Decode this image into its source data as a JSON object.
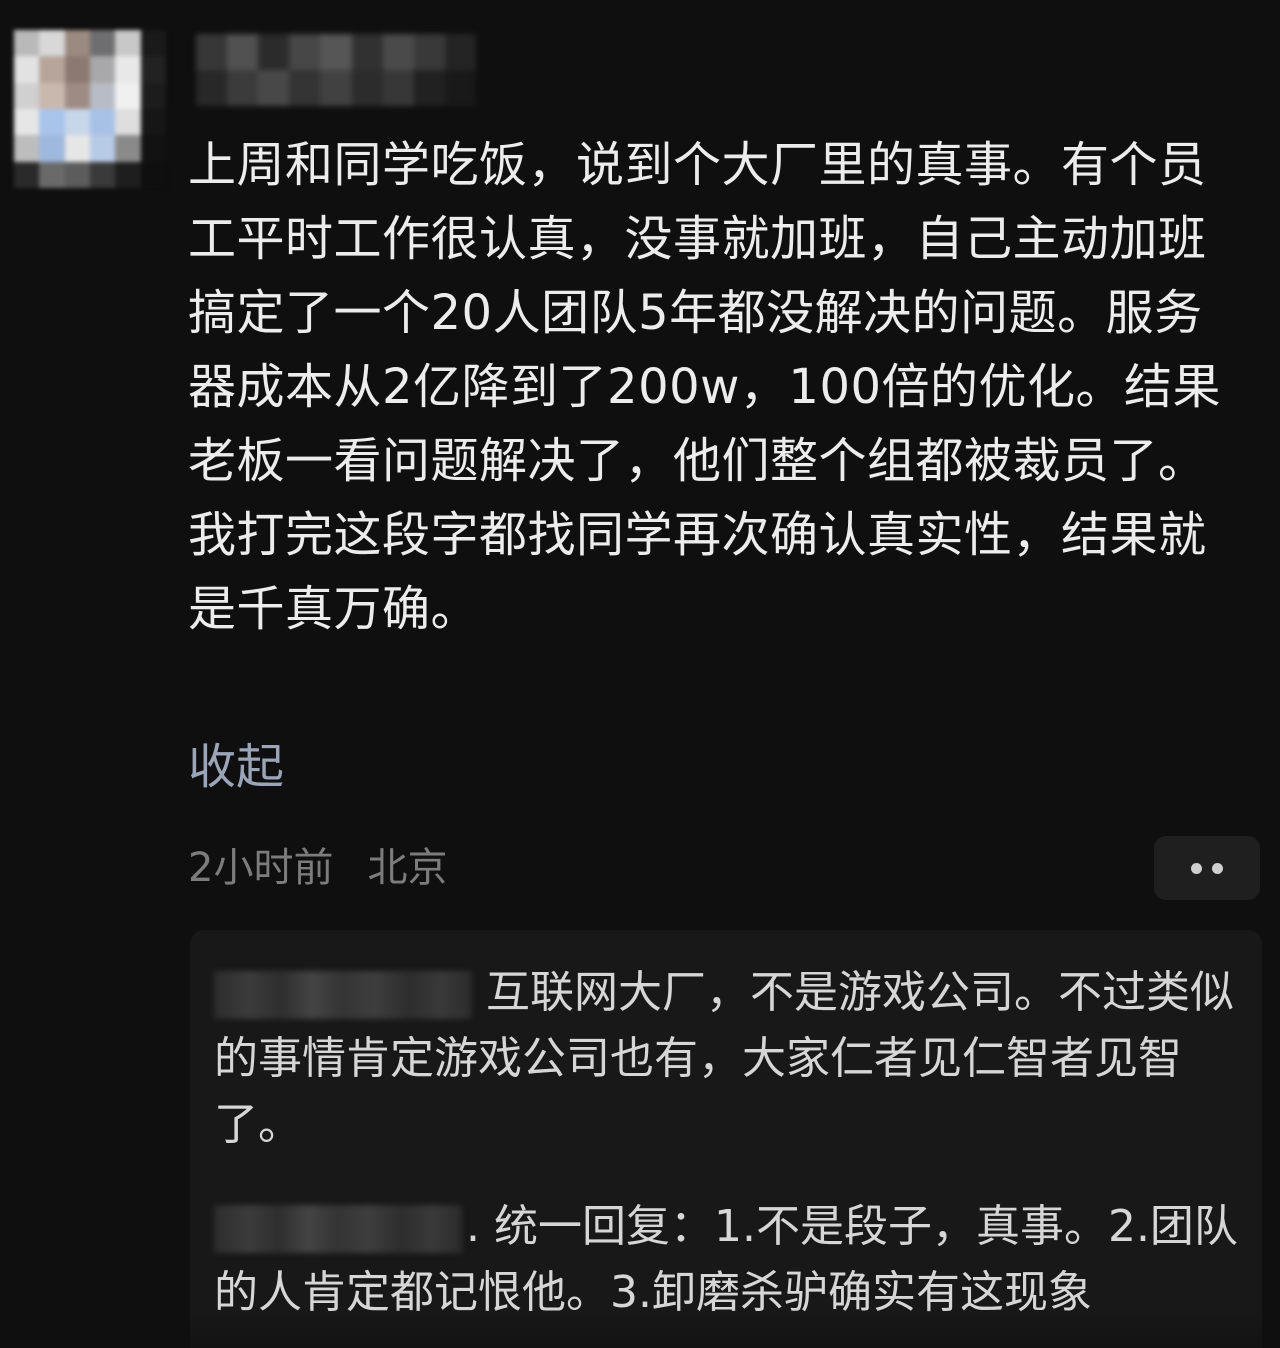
{
  "post": {
    "text": "上周和同学吃饭，说到个大厂里的真事。有个员工平时工作很认真，没事就加班，自己主动加班搞定了一个20人团队5年都没解决的问题。服务器成本从2亿降到了200w，100倍的优化。结果老板一看问题解决了，他们整个组都被裁员了。我打完这段字都找同学再次确认真实性，结果就是千真万确。",
    "collapse_label": "收起",
    "time": "2小时前",
    "location": "北京"
  },
  "replies": [
    {
      "text": "互联网大厂，不是游戏公司。不过类似的事情肯定游戏公司也有，大家仁者见仁智者见智了。"
    },
    {
      "text": ". 统一回复：1.不是段子，真事。2.团队的人肯定都记恨他。3.卸磨杀驴确实有这现象"
    }
  ],
  "colors": {
    "background": "#0f0f0f",
    "text": "#ececec",
    "link": "#9aa5b8",
    "meta": "#7c7c7c",
    "reply_box": "#181818"
  },
  "icons": {
    "more": "more-dots-icon",
    "avatar": "pixelated-avatar"
  }
}
